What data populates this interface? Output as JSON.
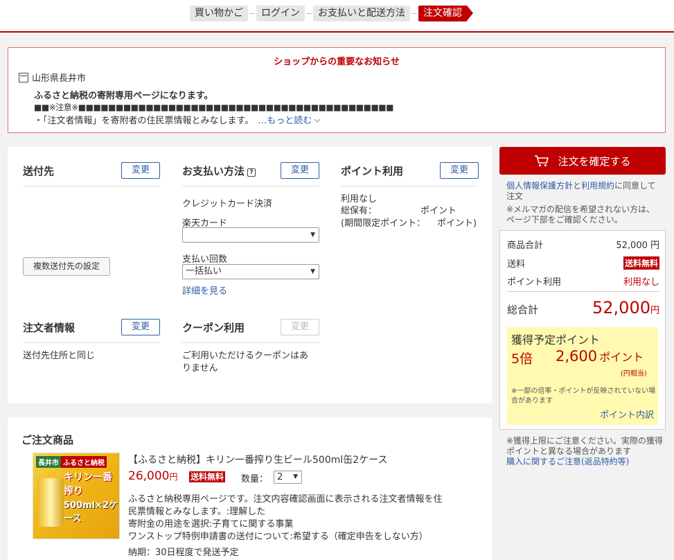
{
  "steps": [
    "買い物かご",
    "ログイン",
    "お支払いと配送方法",
    "注文確認"
  ],
  "notice": {
    "title": "ショップからの重要なお知らせ",
    "shop": "山形県長井市",
    "line1": "ふるさと納税の寄附専用ページになります。",
    "line2": "■■※注意※■■■■■■■■■■■■■■■■■■■■■■■■■■■■■■■■■■■■■■■■■■■■■■■■",
    "line3": "・「注文者情報」を寄附者の住民票情報とみなします。",
    "more": "…もっと読む"
  },
  "shipping": {
    "title": "送付先",
    "change": "変更",
    "multi": "複数送付先の設定"
  },
  "payment": {
    "title": "お支払い方法",
    "change": "変更",
    "method": "クレジットカード決済",
    "card_label": "楽天カード",
    "card_value": "",
    "installment_label": "支払い回数",
    "installment_value": "一括払い",
    "details_link": "詳細を見る"
  },
  "points": {
    "title": "ポイント利用",
    "change": "変更",
    "usage": "利用なし",
    "total_label": "総保有：",
    "total_unit": "ポイント",
    "limited_label": "(期間限定ポイント：",
    "limited_unit": "ポイント)"
  },
  "orderer": {
    "title": "注文者情報",
    "change": "変更",
    "value": "送付先住所と同じ"
  },
  "coupon": {
    "title": "クーポン利用",
    "change": "変更",
    "value_line1": "ご利用いただけるクーポンはあ",
    "value_line2": "りません"
  },
  "order": {
    "title": "ご注文商品",
    "product_name": "【ふるさと納税】キリン一番搾り生ビール500ml缶2ケース",
    "price": "26,000",
    "yen": "円",
    "free_shipping": "送料無料",
    "qty_label": "数量：",
    "qty_value": "2",
    "desc1": "ふるさと納税専用ページです。注文内容確認画面に表示される注文者情報を住",
    "desc2": "民票情報とみなします。:理解した",
    "desc3": "寄附金の用途を選択:子育てに関する事業",
    "desc4": "ワンストップ特例申請書の送付について:希望する（確定申告をしない方）",
    "desc5": "納期：30日程度で発送予定",
    "img_tag1": "長井市",
    "img_tag2": "ふるさと納税",
    "img_title": "キリン一番搾り",
    "img_qty": "500ml×2ケース"
  },
  "side": {
    "confirm": "注文を確定する",
    "agree_link1": "個人情報保護方針",
    "agree_and": "と",
    "agree_link2": "利用規約",
    "agree_rest": "に同意して",
    "agree_rest2": "注文",
    "mail_note1": "※メルマガの配信を希望されない方は、",
    "mail_note2": "ページ下部をご確認ください。",
    "subtotal_label": "商品合計",
    "subtotal_value": "52,000 円",
    "shipping_label": "送料",
    "shipping_value": "送料無料",
    "points_label": "ポイント利用",
    "points_value": "利用なし",
    "total_label": "総合計",
    "total_value": "52,000",
    "total_yen": "円",
    "earn_title": "獲得予定ポイント",
    "earn_rate": "5倍",
    "earn_points": "2,600",
    "earn_unit": "ポイント",
    "earn_yen": "(円相当)",
    "earn_note1": "※一部の倍率・ポイントが反映されていない場",
    "earn_note2": "合があります",
    "earn_link": "ポイント内訳",
    "limit_note1": "※獲得上限にご注意ください。実際の獲得",
    "limit_note2": "ポイントと異なる場合があります",
    "purchase_link": "購入に関するご注意(返品特約等)"
  }
}
